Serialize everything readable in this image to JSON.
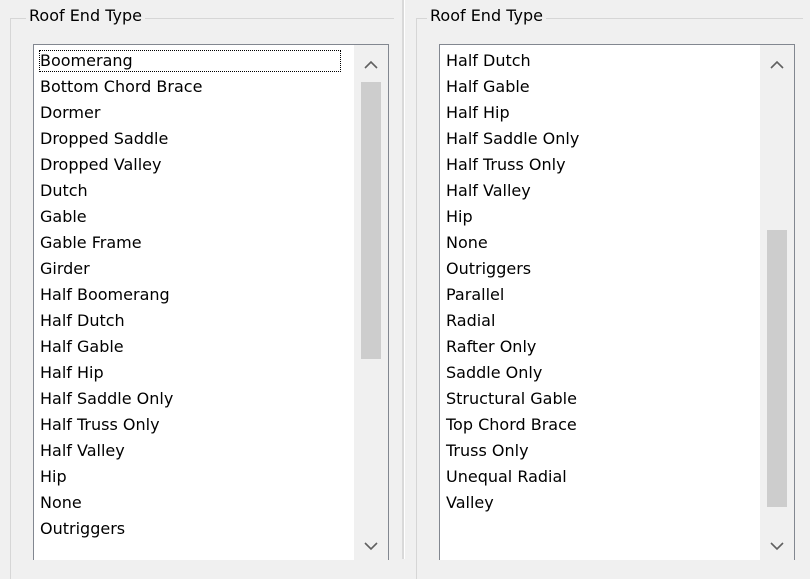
{
  "left_panel": {
    "title": "Roof End Type",
    "items": [
      "Boomerang",
      "Bottom Chord Brace",
      "Dormer",
      "Dropped Saddle",
      "Dropped Valley",
      "Dutch",
      "Gable",
      "Gable Frame",
      "Girder",
      "Half Boomerang",
      "Half Dutch",
      "Half Gable",
      "Half Hip",
      "Half Saddle Only",
      "Half Truss Only",
      "Half Valley",
      "Hip",
      "None",
      "Outriggers"
    ],
    "focused_item": "Boomerang"
  },
  "right_panel": {
    "title": "Roof End Type",
    "items": [
      "Half Dutch",
      "Half Gable",
      "Half Hip",
      "Half Saddle Only",
      "Half Truss Only",
      "Half Valley",
      "Hip",
      "None",
      "Outriggers",
      "Parallel",
      "Radial",
      "Rafter Only",
      "Saddle Only",
      "Structural Gable",
      "Top Chord Brace",
      "Truss Only",
      "Unequal Radial",
      "Valley"
    ]
  },
  "icons": {
    "scroll_up": "chevron-up-icon",
    "scroll_down": "chevron-down-icon"
  }
}
